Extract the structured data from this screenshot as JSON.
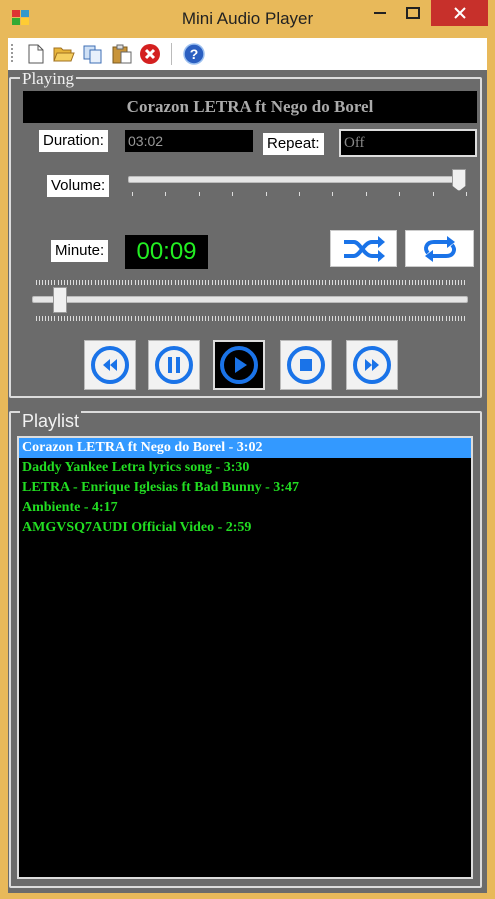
{
  "window": {
    "title": "Mini Audio Player"
  },
  "toolbar": {
    "icons": [
      "new-file-icon",
      "open-folder-icon",
      "copy-icon",
      "paste-icon",
      "delete-icon",
      "help-icon"
    ]
  },
  "playing": {
    "legend": "Playing",
    "track_title": "Corazon LETRA ft Nego do Borel",
    "duration_label": "Duration:",
    "duration_value": "03:02",
    "repeat_label": "Repeat:",
    "repeat_value": "Off",
    "volume_label": "Volume:",
    "volume_level": 1.0,
    "minute_label": "Minute:",
    "minute_value": "00:09",
    "seek_position": 0.05
  },
  "playlist": {
    "legend": "Playlist",
    "selected_index": 0,
    "items": [
      "Corazon LETRA ft Nego do Borel - 3:02",
      "Daddy Yankee Letra lyrics song - 3:30",
      "LETRA - Enrique Iglesias ft Bad Bunny - 3:47",
      "Ambiente - 4:17",
      "AMGVSQ7AUDI Official Video - 2:59"
    ]
  },
  "colors": {
    "accent": "#1a73e8",
    "timer_text": "#22ee22",
    "playlist_text": "#22dd22",
    "selection": "#3399ff",
    "panel": "#6b6b6b",
    "frame": "#e8b95a"
  }
}
